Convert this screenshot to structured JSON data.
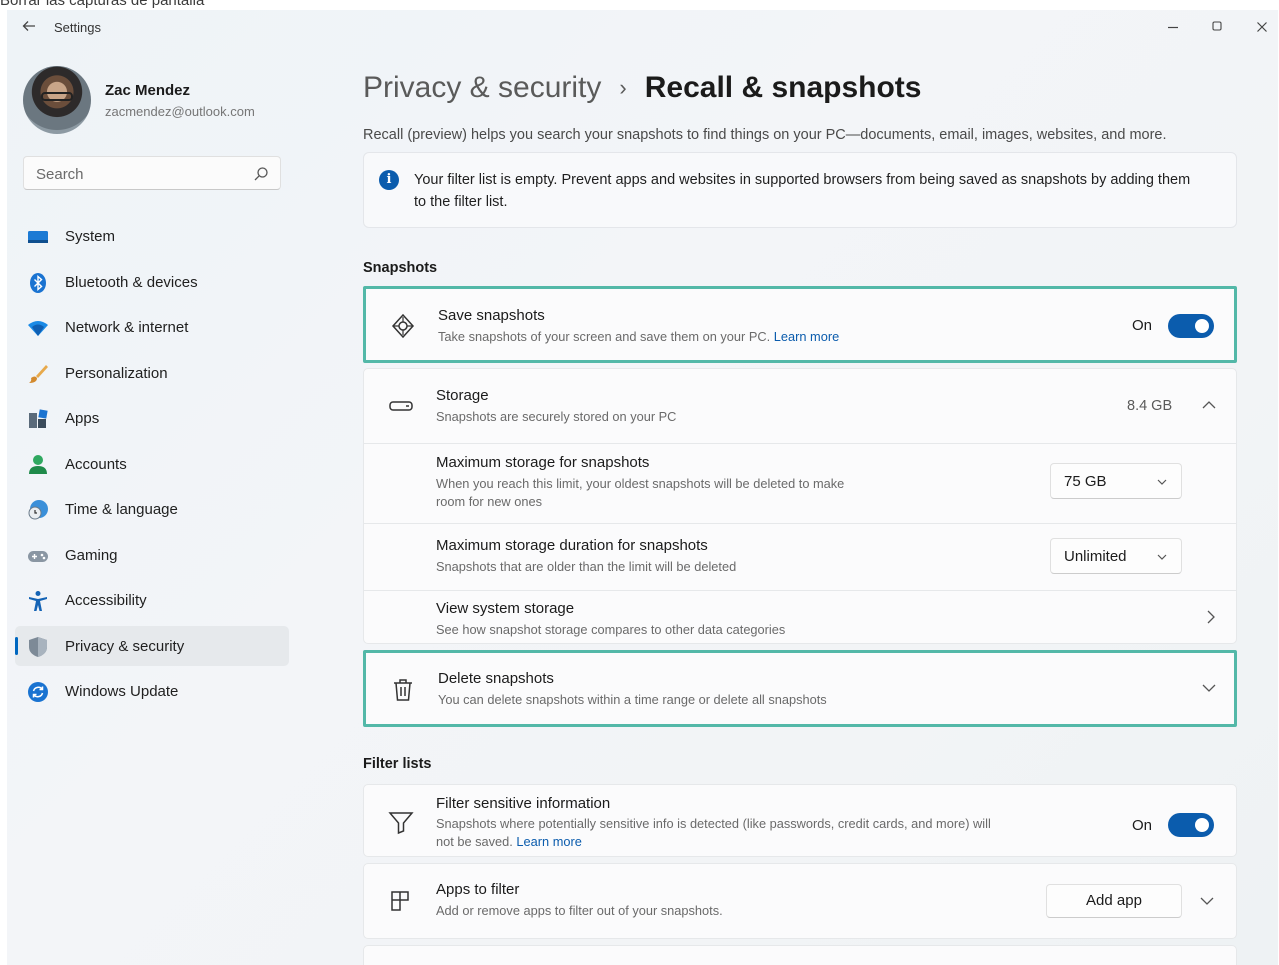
{
  "page_caption": "Borrar las capturas de pantalla",
  "window": {
    "title": "Settings"
  },
  "user": {
    "name": "Zac Mendez",
    "email": "zacmendez@outlook.com"
  },
  "search": {
    "placeholder": "Search"
  },
  "sidebar": {
    "items": [
      {
        "label": "System",
        "icon": "system-icon"
      },
      {
        "label": "Bluetooth & devices",
        "icon": "bluetooth-icon"
      },
      {
        "label": "Network & internet",
        "icon": "wifi-icon"
      },
      {
        "label": "Personalization",
        "icon": "brush-icon"
      },
      {
        "label": "Apps",
        "icon": "apps-icon"
      },
      {
        "label": "Accounts",
        "icon": "person-icon"
      },
      {
        "label": "Time & language",
        "icon": "globe-clock-icon"
      },
      {
        "label": "Gaming",
        "icon": "gamepad-icon"
      },
      {
        "label": "Accessibility",
        "icon": "accessibility-icon"
      },
      {
        "label": "Privacy & security",
        "icon": "shield-icon",
        "active": true
      },
      {
        "label": "Windows Update",
        "icon": "update-icon"
      }
    ]
  },
  "breadcrumb": {
    "parent": "Privacy & security",
    "separator": "›",
    "current": "Recall & snapshots"
  },
  "description": "Recall (preview) helps you search your snapshots to find things on your PC—documents, email, images, websites, and more.",
  "info": {
    "text": "Your filter list is empty. Prevent apps and websites in supported browsers from being saved as snapshots by adding them to the filter list."
  },
  "snapshots": {
    "section_title": "Snapshots",
    "save": {
      "title": "Save snapshots",
      "subtitle": "Take snapshots of your screen and save them on your PC.",
      "link": "Learn more",
      "toggle_label": "On",
      "toggle_on": true
    },
    "storage": {
      "title": "Storage",
      "subtitle": "Snapshots are securely stored on your PC",
      "value": "8.4 GB"
    },
    "max_storage": {
      "title": "Maximum storage for snapshots",
      "subtitle": "When you reach this limit, your oldest snapshots will be deleted to make room for new ones",
      "value": "75 GB"
    },
    "max_duration": {
      "title": "Maximum storage duration for snapshots",
      "subtitle": "Snapshots that are older than the limit will be deleted",
      "value": "Unlimited"
    },
    "view_storage": {
      "title": "View system storage",
      "subtitle": "See how snapshot storage compares to other data categories"
    },
    "delete": {
      "title": "Delete snapshots",
      "subtitle": "You can delete snapshots within a time range or delete all snapshots"
    }
  },
  "filter_lists": {
    "section_title": "Filter lists",
    "sensitive": {
      "title": "Filter sensitive information",
      "subtitle": "Snapshots where potentially sensitive info is detected (like passwords, credit cards, and more) will not be saved.",
      "link": "Learn more",
      "toggle_label": "On",
      "toggle_on": true
    },
    "apps": {
      "title": "Apps to filter",
      "subtitle": "Add or remove apps to filter out of your snapshots.",
      "button": "Add app"
    }
  },
  "colors": {
    "accent": "#0b5cad",
    "highlight": "#53b8a8"
  }
}
